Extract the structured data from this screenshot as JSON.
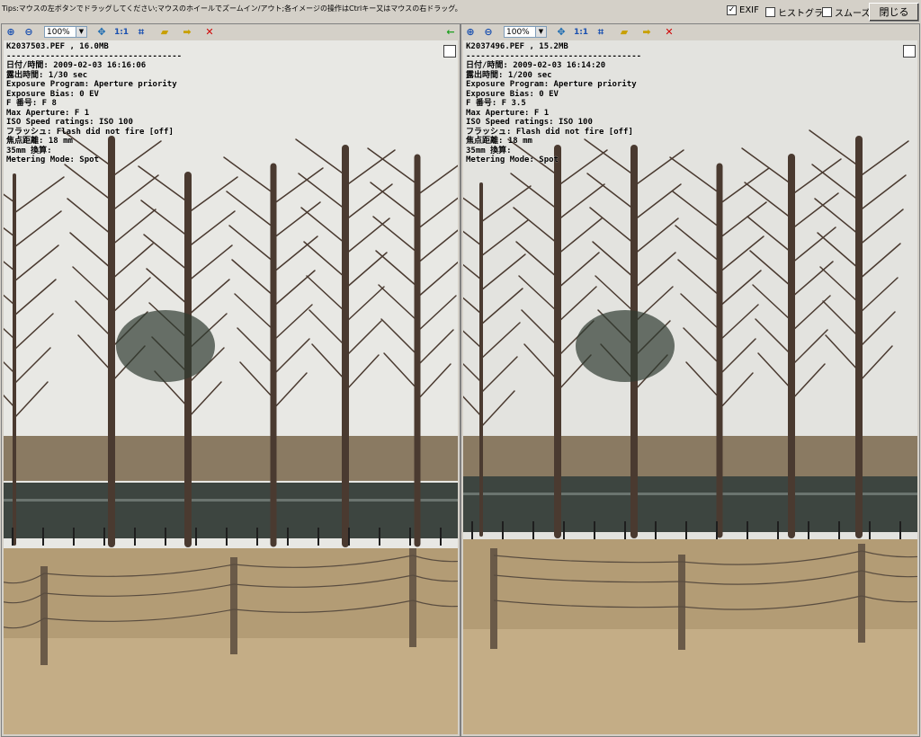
{
  "topbar": {
    "tip": "Tips:マウスの左ボタンでドラッグしてください;マウスのホイールでズームイン/アウト;各イメージの操作はCtrlキー又はマウスの右ドラッグ。",
    "exif_label": "EXIF",
    "exif_checked": true,
    "histogram_label": "ヒストグラ",
    "histogram_checked": false,
    "smooth_label": "スムーズ",
    "smooth_checked": false,
    "close_label": "閉じる"
  },
  "toolbar_icons": {
    "zoom_in": "zoom-in-icon",
    "zoom_out": "zoom-out-icon",
    "fit": "fit-icon",
    "actual": "actual-size-icon",
    "crop": "crop-icon",
    "folder": "folder-icon",
    "next": "next-arrow-icon",
    "close": "close-icon"
  },
  "left": {
    "zoom": "100%",
    "one_to_one": "1:1",
    "back_arrow": "←",
    "file": "K2037503.PEF , 16.0MB",
    "separator": "------------------------------------",
    "lines": [
      "日付/時間: 2009-02-03 16:16:06",
      "露出時間: 1/30 sec",
      "Exposure Program: Aperture priority",
      "Exposure Bias: 0 EV",
      "F 番号: F 8",
      "Max Aperture: F 1",
      "ISO Speed ratings: ISO 100",
      "フラッシュ: Flash did not fire [off]",
      "焦点距離: 18 mm",
      "35mm 換算:",
      "Metering Mode: Spot"
    ]
  },
  "right": {
    "zoom": "100%",
    "one_to_one": "1:1",
    "file": "K2037496.PEF , 15.2MB",
    "separator": "------------------------------------",
    "lines": [
      "日付/時間: 2009-02-03 16:14:20",
      "露出時間: 1/200 sec",
      "Exposure Program: Aperture priority",
      "Exposure Bias: 0 EV",
      "F 番号: F 3.5",
      "Max Aperture: F 1",
      "ISO Speed ratings: ISO 100",
      "フラッシュ: Flash did not fire [off]",
      "焦点距離: 18 mm",
      "35mm 換算:",
      "Metering Mode: Spot"
    ]
  },
  "colors": {
    "sky_left": "#e8e8e4",
    "sky_right": "#e3e3df",
    "ground": "#c4ad86",
    "water": "#3d4540",
    "trees": "#4a3a30"
  }
}
